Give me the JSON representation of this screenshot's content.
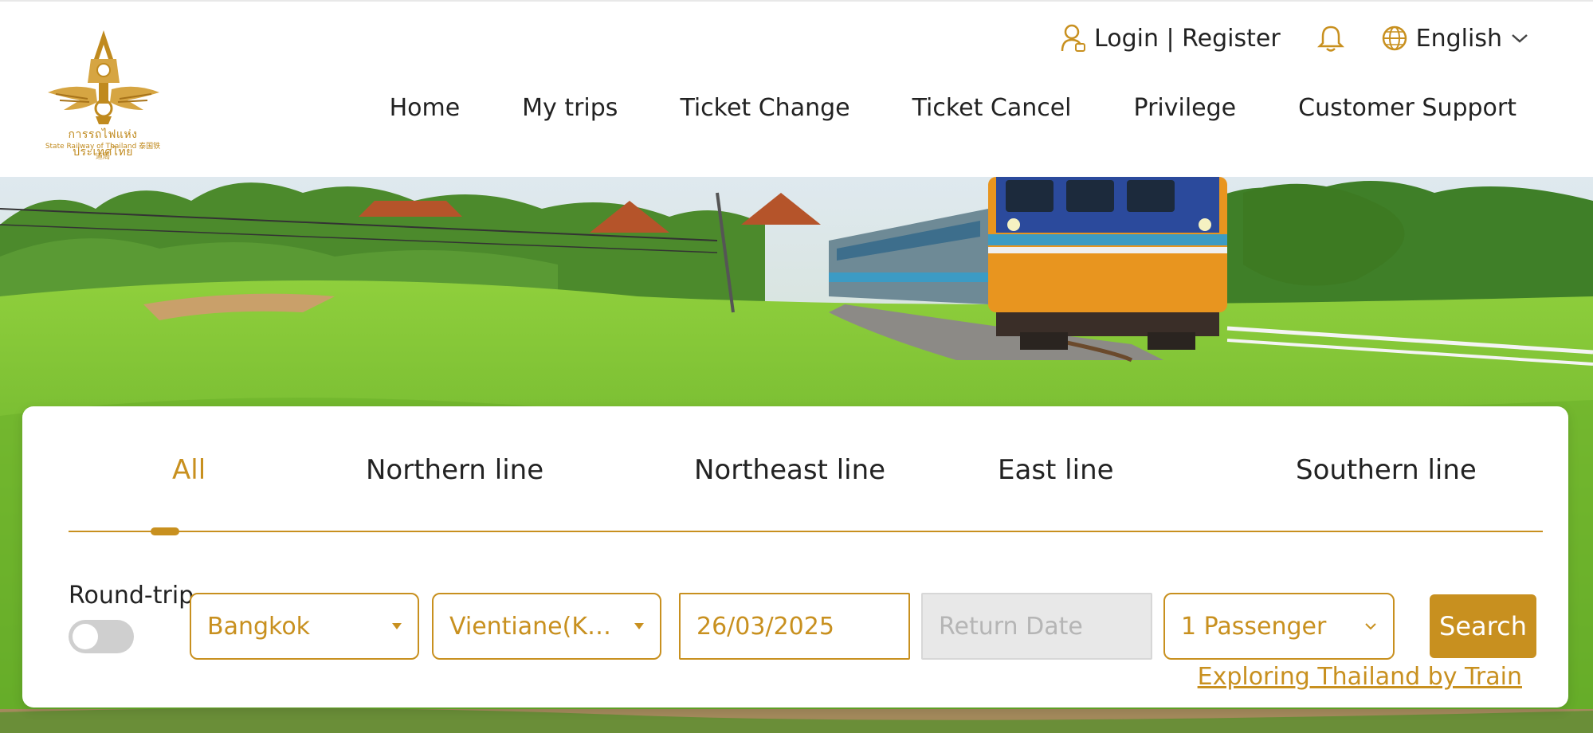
{
  "header": {
    "logo": {
      "thai_text": "การรถไฟแห่งประเทศไทย",
      "english_text": "State Railway of Thailand 泰国铁道局"
    },
    "topbar": {
      "login_label": "Login | Register",
      "language_label": "English"
    },
    "nav": [
      {
        "label": "Home"
      },
      {
        "label": "My trips"
      },
      {
        "label": "Ticket Change"
      },
      {
        "label": "Ticket Cancel"
      },
      {
        "label": "Privilege"
      },
      {
        "label": "Customer Support"
      }
    ]
  },
  "search": {
    "tabs": [
      {
        "label": "All",
        "active": true
      },
      {
        "label": "Northern line"
      },
      {
        "label": "Northeast line"
      },
      {
        "label": "East line"
      },
      {
        "label": "Southern line"
      }
    ],
    "round_trip_label": "Round-trip",
    "round_trip_enabled": false,
    "origin": "Bangkok",
    "destination": "Vientiane(Kha...",
    "departure_date": "26/03/2025",
    "return_date_placeholder": "Return Date",
    "passengers": "1 Passenger",
    "search_label": "Search",
    "explore_link": "Exploring Thailand by Train"
  },
  "colors": {
    "accent": "#c8901f",
    "disabled_bg": "#e8e8e8",
    "text": "#222222"
  }
}
